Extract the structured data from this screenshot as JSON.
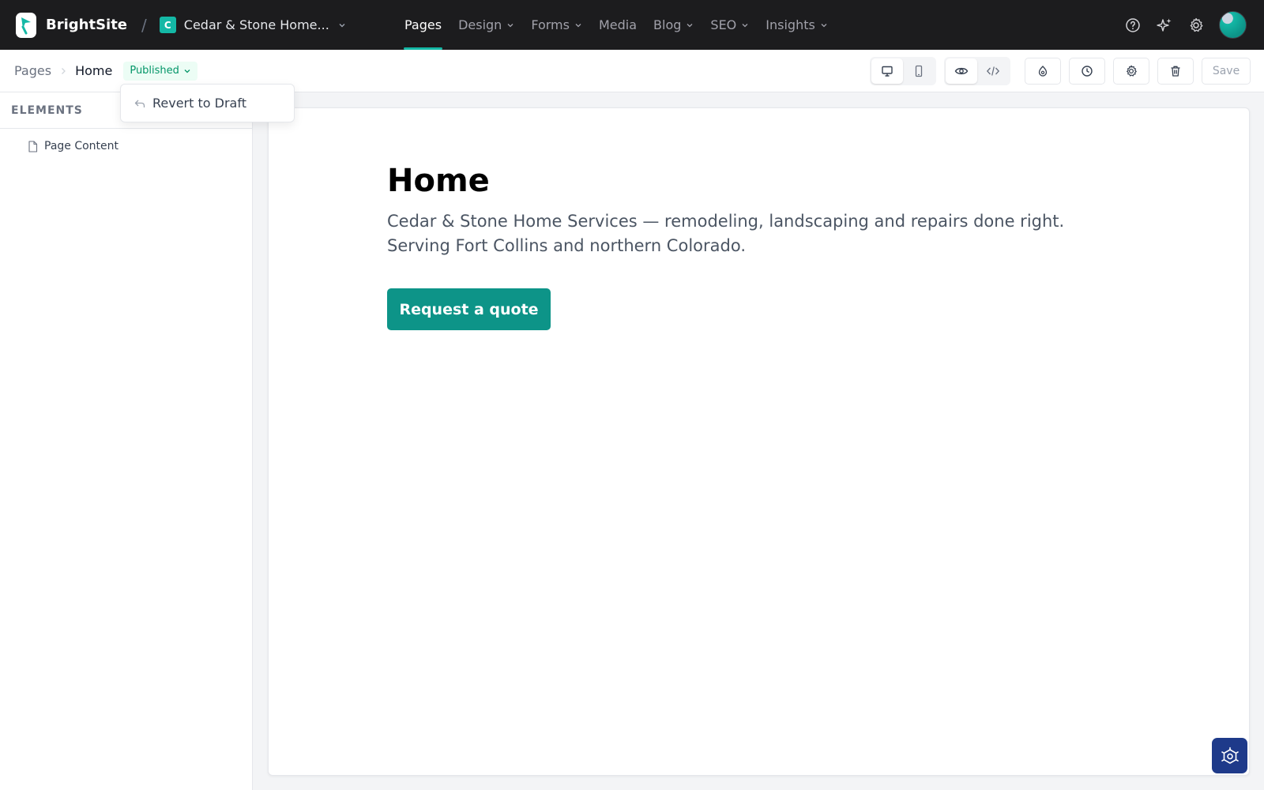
{
  "app": {
    "name": "BrightSite",
    "site_badge": "C",
    "site_name": "Cedar & Stone Home..."
  },
  "nav": {
    "items": [
      {
        "label": "Pages"
      },
      {
        "label": "Design"
      },
      {
        "label": "Forms"
      },
      {
        "label": "Media"
      },
      {
        "label": "Blog"
      },
      {
        "label": "SEO"
      },
      {
        "label": "Insights"
      }
    ],
    "active": "Pages"
  },
  "breadcrumb": {
    "parent": "Pages",
    "current": "Home"
  },
  "status": {
    "label": "Published"
  },
  "dropdown": {
    "item": "Revert to Draft"
  },
  "toolbar": {
    "save_label": "Save"
  },
  "panel": {
    "title": "ELEMENTS",
    "items": [
      {
        "label": "Page Content"
      }
    ]
  },
  "page": {
    "title": "Home",
    "lead": "Cedar & Stone Home Services — remodeling, landscaping and repairs done right. Serving Fort Collins and northern Colorado.",
    "cta": "Request a quote"
  },
  "icons": {
    "logo": "brightsite-logo-icon",
    "help": "help-icon",
    "ai": "sparkles-icon",
    "settings": "gear-icon",
    "desktop": "desktop-icon",
    "mobile": "mobile-icon",
    "preview": "eye-icon",
    "code": "code-icon",
    "styles": "palette-icon",
    "history": "clock-icon",
    "page_settings": "gear-icon",
    "delete": "trash-icon",
    "revert": "undo-icon",
    "file": "file-icon",
    "bug": "bug-icon"
  },
  "colors": {
    "accent": "#14b8a6",
    "brand_dark": "#1c1c1e",
    "success": "#059669",
    "cta": "#0d9488",
    "bug_button": "#1e3a8a"
  }
}
